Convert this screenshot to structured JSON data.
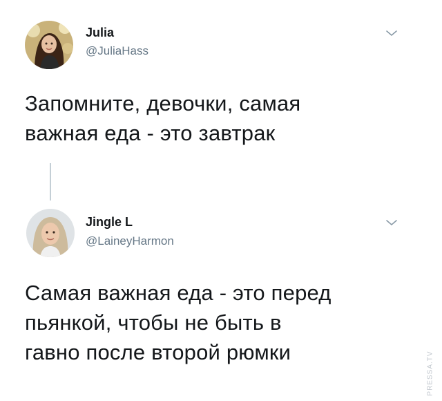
{
  "tweets": [
    {
      "author_name": "Julia",
      "author_handle": "@JuliaHass",
      "menu_icon": "chevron-down-icon",
      "text_lines": [
        "Запомните, девочки, самая",
        "важная еда - это завтрак"
      ]
    },
    {
      "author_name": "Jingle L",
      "author_handle": "@LaineyHarmon",
      "menu_icon": "chevron-down-icon",
      "text_lines": [
        "Самая важная еда - это перед",
        "пьянкой, чтобы не быть в",
        "гавно после второй рюмки"
      ]
    }
  ],
  "watermark": "PRESSA.TV",
  "colors": {
    "text": "#14171a",
    "secondary": "#657786",
    "thread_line": "#c4cfd6",
    "background": "#ffffff"
  }
}
